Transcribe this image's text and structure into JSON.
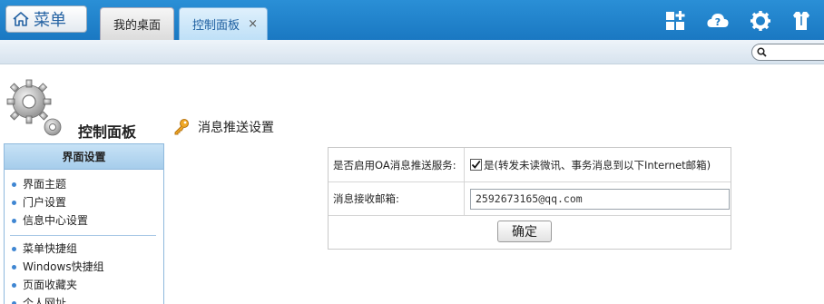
{
  "topbar": {
    "menu_label": "菜单",
    "tabs": [
      {
        "label": "我的桌面"
      },
      {
        "label": "控制面板",
        "close": "×"
      }
    ],
    "icons": [
      "add-shortcut-icon",
      "help-cloud-icon",
      "settings-gear-icon",
      "user-shirt-icon"
    ]
  },
  "search": {
    "placeholder": ""
  },
  "sidebar": {
    "panel_title": "控制面板",
    "header": "界面设置",
    "group1": [
      {
        "label": "界面主题"
      },
      {
        "label": "门户设置"
      },
      {
        "label": "信息中心设置"
      }
    ],
    "group2": [
      {
        "label": "菜单快捷组"
      },
      {
        "label": "Windows快捷组"
      },
      {
        "label": "页面收藏夹"
      },
      {
        "label": "个人网址"
      }
    ]
  },
  "main": {
    "section_title": "消息推送设置",
    "form": {
      "enable_label": "是否启用OA消息推送服务:",
      "enable_checked": true,
      "enable_option": "是(转发未读微讯、事务消息到以下Internet邮箱)",
      "email_label": "消息接收邮箱:",
      "email_value": "2592673165@qq.com",
      "confirm_label": "确定"
    }
  },
  "colors": {
    "topbar": "#1a78c2",
    "accent": "#3f86d2",
    "tab_active_text": "#1e5fa0"
  }
}
